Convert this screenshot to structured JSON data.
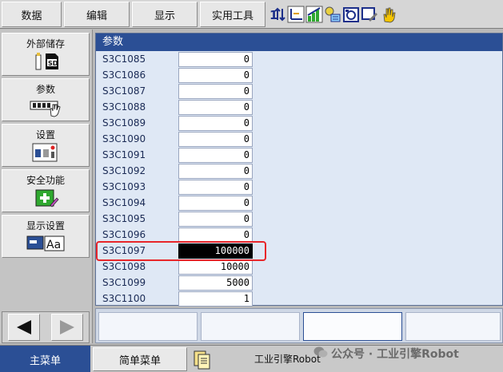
{
  "top_menu": {
    "items": [
      "数据",
      "编辑",
      "显示",
      "实用工具"
    ]
  },
  "toolbar": {
    "icons": [
      "axis-switch-icon",
      "coord-frame-icon",
      "speed-bars-icon",
      "teach-tool-icon",
      "camera-icon",
      "edit-screen-icon",
      "hand-icon"
    ]
  },
  "sidebar": {
    "items": [
      {
        "label": "外部储存",
        "icon": "sd-card-icon"
      },
      {
        "label": "参数",
        "icon": "parameter-hand-icon"
      },
      {
        "label": "设置",
        "icon": "settings-panel-icon"
      },
      {
        "label": "安全功能",
        "icon": "safety-cross-icon"
      },
      {
        "label": "显示设置",
        "icon": "display-font-icon"
      }
    ],
    "nav": {
      "prev": "◀",
      "next": "▶"
    }
  },
  "main": {
    "title": "参数",
    "rows": [
      {
        "name": "S3C1085",
        "value": "0"
      },
      {
        "name": "S3C1086",
        "value": "0"
      },
      {
        "name": "S3C1087",
        "value": "0"
      },
      {
        "name": "S3C1088",
        "value": "0"
      },
      {
        "name": "S3C1089",
        "value": "0"
      },
      {
        "name": "S3C1090",
        "value": "0"
      },
      {
        "name": "S3C1091",
        "value": "0"
      },
      {
        "name": "S3C1092",
        "value": "0"
      },
      {
        "name": "S3C1093",
        "value": "0"
      },
      {
        "name": "S3C1094",
        "value": "0"
      },
      {
        "name": "S3C1095",
        "value": "0"
      },
      {
        "name": "S3C1096",
        "value": "0"
      },
      {
        "name": "S3C1097",
        "value": "100000",
        "selected": true
      },
      {
        "name": "S3C1098",
        "value": "10000"
      },
      {
        "name": "S3C1099",
        "value": "5000"
      },
      {
        "name": "S3C1100",
        "value": "1"
      }
    ]
  },
  "bottom": {
    "main_menu": "主菜单",
    "simple_menu": "简单菜单",
    "status": "工业引擎Robot",
    "watermark": "公众号 · 工业引擎Robot"
  },
  "colors": {
    "title_blue": "#2b4f95",
    "panel_bg": "#dfe8f5",
    "highlight_red": "#e8262a"
  }
}
